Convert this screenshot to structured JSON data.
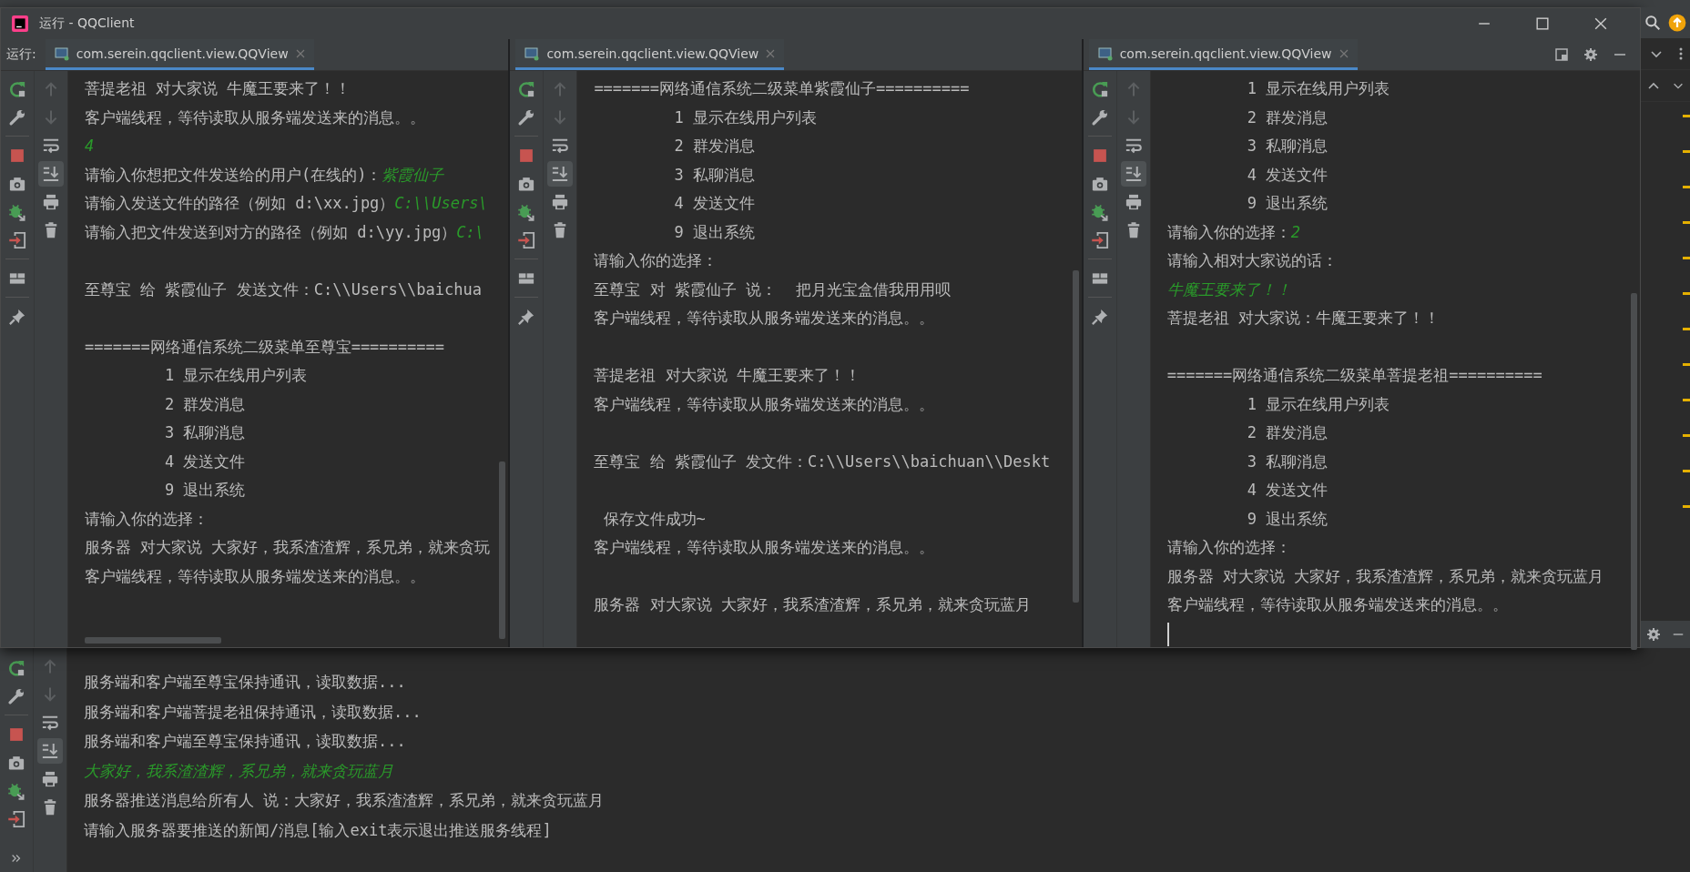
{
  "window": {
    "title": "运行 - QQClient",
    "run_label": "运行:"
  },
  "panes": [
    {
      "tab": {
        "label": "com.serein.qqclient.view.QQView",
        "selected": true
      },
      "autoscroll_on": true,
      "lines": [
        {
          "kind": "line",
          "text": "菩提老祖 对大家说 牛魔王要来了！！"
        },
        {
          "kind": "line",
          "text": "客户端线程，等待读取从服务端发送来的消息。。"
        },
        {
          "kind": "line",
          "input": "4"
        },
        {
          "kind": "line",
          "text": "请输入你想把文件发送给的用户(在线的)：",
          "input": "紫霞仙子"
        },
        {
          "kind": "line",
          "text": "请输入发送文件的路径（例如 d:\\xx.jpg）",
          "input": "C:\\\\Users\\"
        },
        {
          "kind": "line",
          "text": "请输入把文件发送到对方的路径（例如 d:\\yy.jpg）",
          "input": "C:\\"
        },
        {
          "kind": "blank"
        },
        {
          "kind": "line",
          "text": "至尊宝 给 紫霞仙子 发送文件：C:\\\\Users\\\\baichua"
        },
        {
          "kind": "blank"
        },
        {
          "kind": "line",
          "text": "=======网络通信系统二级菜单至尊宝=========="
        },
        {
          "kind": "menu",
          "text": "1 显示在线用户列表"
        },
        {
          "kind": "menu",
          "text": "2 群发消息"
        },
        {
          "kind": "menu",
          "text": "3 私聊消息"
        },
        {
          "kind": "menu",
          "text": "4 发送文件"
        },
        {
          "kind": "menu",
          "text": "9 退出系统"
        },
        {
          "kind": "line",
          "text": "请输入你的选择："
        },
        {
          "kind": "line",
          "text": "服务器 对大家说 大家好，我系渣渣辉，系兄弟，就来贪玩"
        },
        {
          "kind": "line",
          "text": "客户端线程，等待读取从服务端发送来的消息。。"
        }
      ]
    },
    {
      "tab": {
        "label": "com.serein.qqclient.view.QQView",
        "selected": true
      },
      "autoscroll_on": true,
      "lines": [
        {
          "kind": "line",
          "text": "=======网络通信系统二级菜单紫霞仙子=========="
        },
        {
          "kind": "menu",
          "text": "1 显示在线用户列表"
        },
        {
          "kind": "menu",
          "text": "2 群发消息"
        },
        {
          "kind": "menu",
          "text": "3 私聊消息"
        },
        {
          "kind": "menu",
          "text": "4 发送文件"
        },
        {
          "kind": "menu",
          "text": "9 退出系统"
        },
        {
          "kind": "line",
          "text": "请输入你的选择："
        },
        {
          "kind": "line",
          "text": "至尊宝 对 紫霞仙子 说：  把月光宝盒借我用用呗"
        },
        {
          "kind": "line",
          "text": "客户端线程，等待读取从服务端发送来的消息。。"
        },
        {
          "kind": "blank"
        },
        {
          "kind": "line",
          "text": "菩提老祖 对大家说 牛魔王要来了！！"
        },
        {
          "kind": "line",
          "text": "客户端线程，等待读取从服务端发送来的消息。。"
        },
        {
          "kind": "blank"
        },
        {
          "kind": "line",
          "text": "至尊宝 给 紫霞仙子 发文件：C:\\\\Users\\\\baichuan\\\\Deskt"
        },
        {
          "kind": "blank"
        },
        {
          "kind": "line",
          "text": " 保存文件成功~"
        },
        {
          "kind": "line",
          "text": "客户端线程，等待读取从服务端发送来的消息。。"
        },
        {
          "kind": "blank"
        },
        {
          "kind": "line",
          "text": "服务器 对大家说 大家好，我系渣渣辉，系兄弟，就来贪玩蓝月"
        }
      ]
    },
    {
      "tab": {
        "label": "com.serein.qqclient.view.QQView",
        "selected": true
      },
      "autoscroll_on": true,
      "lines": [
        {
          "kind": "menu",
          "text": "1 显示在线用户列表"
        },
        {
          "kind": "menu",
          "text": "2 群发消息"
        },
        {
          "kind": "menu",
          "text": "3 私聊消息"
        },
        {
          "kind": "menu",
          "text": "4 发送文件"
        },
        {
          "kind": "menu",
          "text": "9 退出系统"
        },
        {
          "kind": "line",
          "text": "请输入你的选择：",
          "input": "2"
        },
        {
          "kind": "line",
          "text": "请输入相对大家说的话："
        },
        {
          "kind": "line",
          "input": "牛魔王要来了！！"
        },
        {
          "kind": "line",
          "text": "菩提老祖 对大家说：牛魔王要来了！！"
        },
        {
          "kind": "blank"
        },
        {
          "kind": "line",
          "text": "=======网络通信系统二级菜单菩提老祖=========="
        },
        {
          "kind": "menu",
          "text": "1 显示在线用户列表"
        },
        {
          "kind": "menu",
          "text": "2 群发消息"
        },
        {
          "kind": "menu",
          "text": "3 私聊消息"
        },
        {
          "kind": "menu",
          "text": "4 发送文件"
        },
        {
          "kind": "menu",
          "text": "9 退出系统"
        },
        {
          "kind": "line",
          "text": "请输入你的选择："
        },
        {
          "kind": "line",
          "text": "服务器 对大家说 大家好，我系渣渣辉，系兄弟，就来贪玩蓝月"
        },
        {
          "kind": "line",
          "text": "客户端线程，等待读取从服务端发送来的消息。。"
        },
        {
          "kind": "cursor"
        }
      ]
    }
  ],
  "server_console": {
    "autoscroll_on": true,
    "lines": [
      {
        "kind": "line",
        "text": "服务端和客户端至尊宝保持通讯，读取数据..."
      },
      {
        "kind": "line",
        "text": "服务端和客户端菩提老祖保持通讯，读取数据..."
      },
      {
        "kind": "line",
        "text": "服务端和客户端至尊宝保持通讯，读取数据..."
      },
      {
        "kind": "line",
        "input": "大家好，我系渣渣辉，系兄弟，就来贪玩蓝月"
      },
      {
        "kind": "line",
        "text": "服务器推送消息给所有人 说：大家好，我系渣渣辉，系兄弟，就来贪玩蓝月"
      },
      {
        "kind": "line",
        "text": "请输入服务器要推送的新闻/消息[输入exit表示退出推送服务线程]"
      }
    ]
  }
}
